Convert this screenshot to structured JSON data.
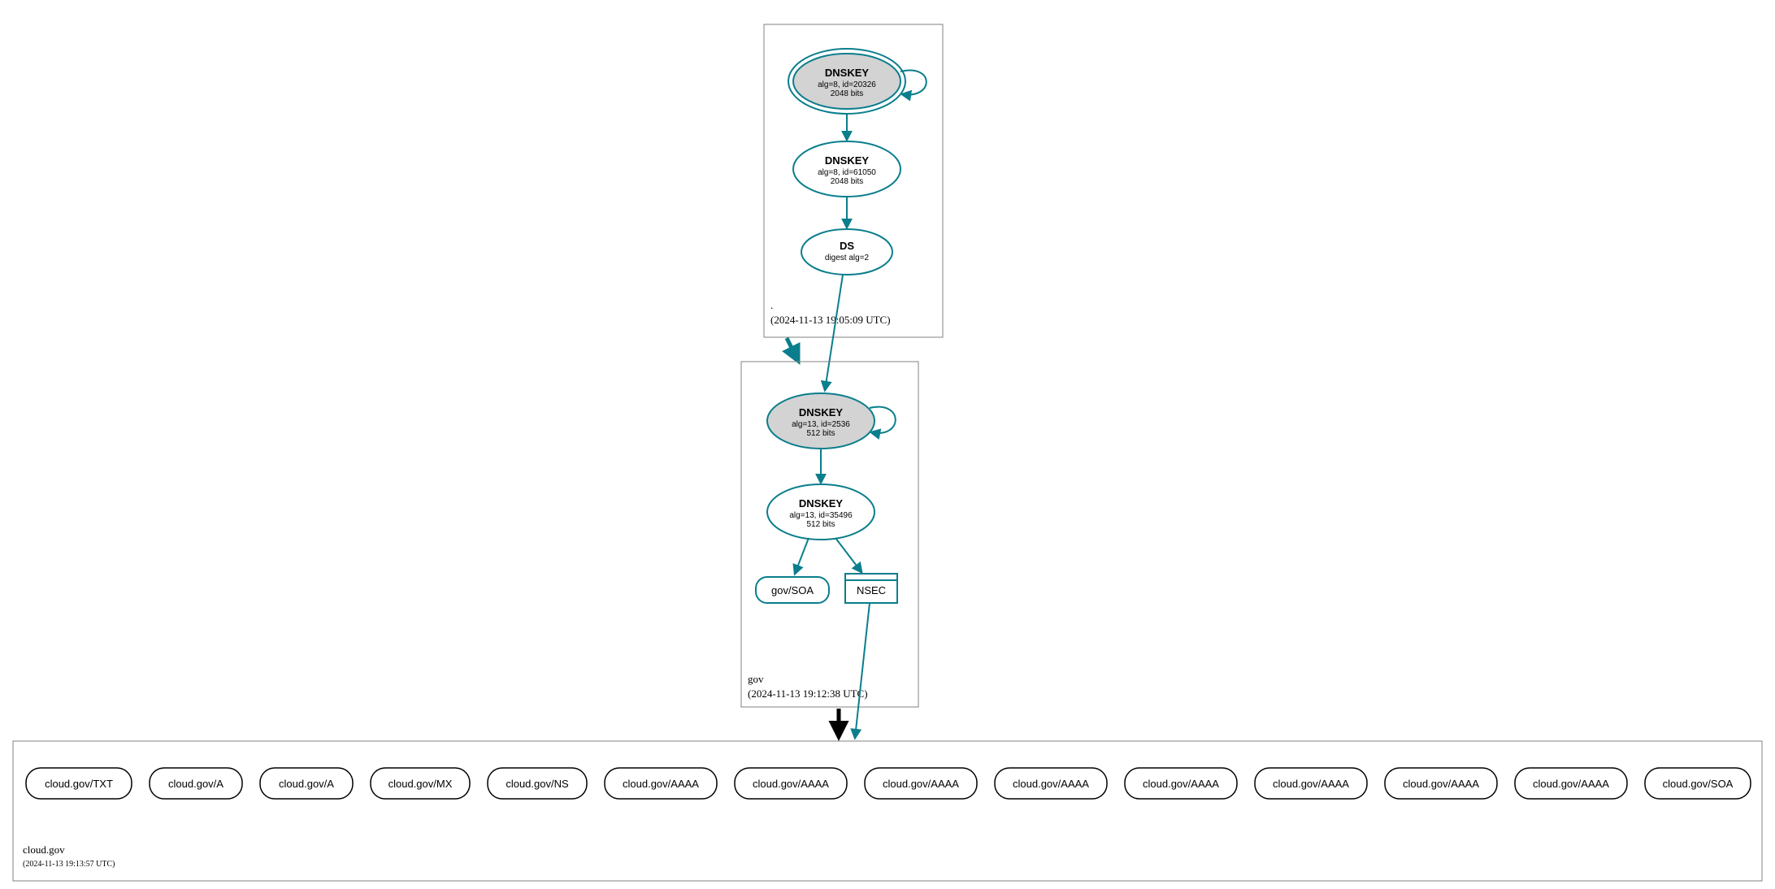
{
  "zones": {
    "root": {
      "name": ".",
      "timestamp": "(2024-11-13 19:05:09 UTC)",
      "dnskey_ksk": {
        "title": "DNSKEY",
        "line1": "alg=8, id=20326",
        "line2": "2048 bits"
      },
      "dnskey_zsk": {
        "title": "DNSKEY",
        "line1": "alg=8, id=61050",
        "line2": "2048 bits"
      },
      "ds": {
        "title": "DS",
        "line1": "digest alg=2"
      }
    },
    "gov": {
      "name": "gov",
      "timestamp": "(2024-11-13 19:12:38 UTC)",
      "dnskey_ksk": {
        "title": "DNSKEY",
        "line1": "alg=13, id=2536",
        "line2": "512 bits"
      },
      "dnskey_zsk": {
        "title": "DNSKEY",
        "line1": "alg=13, id=35496",
        "line2": "512 bits"
      },
      "soa": {
        "label": "gov/SOA"
      },
      "nsec": {
        "label": "NSEC"
      }
    },
    "cloudgov": {
      "name": "cloud.gov",
      "timestamp": "(2024-11-13 19:13:57 UTC)"
    }
  },
  "rrsets": [
    "cloud.gov/TXT",
    "cloud.gov/A",
    "cloud.gov/A",
    "cloud.gov/MX",
    "cloud.gov/NS",
    "cloud.gov/AAAA",
    "cloud.gov/AAAA",
    "cloud.gov/AAAA",
    "cloud.gov/AAAA",
    "cloud.gov/AAAA",
    "cloud.gov/AAAA",
    "cloud.gov/AAAA",
    "cloud.gov/AAAA",
    "cloud.gov/SOA"
  ]
}
